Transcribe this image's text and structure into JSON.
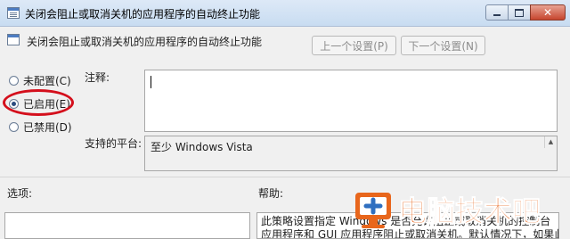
{
  "window": {
    "title": "关闭会阻止或取消关机的应用程序的自动终止功能",
    "minimize_icon": "minimize-icon",
    "maximize_icon": "maximize-icon",
    "close_icon": "close-icon",
    "close_glyph": "✕"
  },
  "header": {
    "setting_title": "关闭会阻止或取消关机的应用程序的自动终止功能",
    "prev_button": "上一个设置(P)",
    "next_button": "下一个设置(N)"
  },
  "state_options": [
    {
      "label": "未配置(C)",
      "selected": false
    },
    {
      "label": "已启用(E)",
      "selected": true
    },
    {
      "label": "已禁用(D)",
      "selected": false
    }
  ],
  "comment": {
    "label": "注释:",
    "value": ""
  },
  "supported_on": {
    "label": "支持的平台:",
    "value": "至少 Windows Vista"
  },
  "options": {
    "label": "选项:"
  },
  "help": {
    "label": "帮助:",
    "line1": "此策略设置指定 Windows 是否允许阻止或取消关机的控制台",
    "line2": "应用程序和 GUI 应用程序阻止或取消关机。默认情况下，如果此"
  },
  "watermark": {
    "text": "电脑技术吧",
    "logo_icon": "computer-logo-icon"
  },
  "colors": {
    "highlight": "#d40f1c",
    "watermark_text": "#e8661c"
  }
}
